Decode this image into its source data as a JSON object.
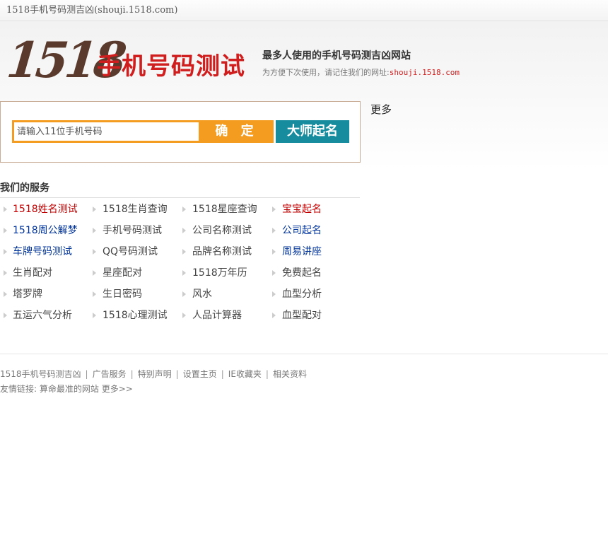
{
  "window": {
    "title": "1518手机号码测吉凶(shouji.1518.com)"
  },
  "header": {
    "logo_number": "1518",
    "logo_text": "手机号码测试",
    "slogan": "最多人使用的手机号码测吉凶网站",
    "remind_prefix": "为方便下次使用，请记住我们的网址:",
    "remind_url": "shouji.1518.com"
  },
  "search": {
    "placeholder": "请输入11位手机号码",
    "confirm_label": "确 定",
    "master_label": "大师起名"
  },
  "more_link": "更多",
  "services": {
    "title": "我们的服务",
    "items": [
      {
        "label": "1518姓名测试",
        "color": "red"
      },
      {
        "label": "1518生肖查询",
        "color": "gray"
      },
      {
        "label": "1518星座查询",
        "color": "gray"
      },
      {
        "label": "宝宝起名",
        "color": "red"
      },
      {
        "label": "1518周公解梦",
        "color": "blue"
      },
      {
        "label": "手机号码测试",
        "color": "gray"
      },
      {
        "label": "公司名称测试",
        "color": "gray"
      },
      {
        "label": "公司起名",
        "color": "blue"
      },
      {
        "label": "车牌号码测试",
        "color": "blue"
      },
      {
        "label": "QQ号码测试",
        "color": "gray"
      },
      {
        "label": "品牌名称测试",
        "color": "gray"
      },
      {
        "label": "周易讲座",
        "color": "blue"
      },
      {
        "label": "生肖配对",
        "color": "gray"
      },
      {
        "label": "星座配对",
        "color": "gray"
      },
      {
        "label": "1518万年历",
        "color": "gray"
      },
      {
        "label": "免费起名",
        "color": "gray"
      },
      {
        "label": "塔罗牌",
        "color": "gray"
      },
      {
        "label": "生日密码",
        "color": "gray"
      },
      {
        "label": "风水",
        "color": "gray"
      },
      {
        "label": "血型分析",
        "color": "gray"
      },
      {
        "label": "五运六气分析",
        "color": "gray"
      },
      {
        "label": "1518心理测试",
        "color": "gray"
      },
      {
        "label": "人品计算器",
        "color": "gray"
      },
      {
        "label": "血型配对",
        "color": "gray"
      }
    ]
  },
  "footer": {
    "links": [
      "1518手机号码测吉凶",
      "广告服务",
      "特别声明",
      "设置主页",
      "IE收藏夹",
      "相关资料"
    ],
    "friend_prefix": "友情链接:",
    "friend_site": "算命最准的网站",
    "friend_more": "更多>>"
  },
  "colors": {
    "accent_orange": "#f39c1f",
    "accent_teal": "#178c9e",
    "brand_red": "#d01e1e"
  }
}
